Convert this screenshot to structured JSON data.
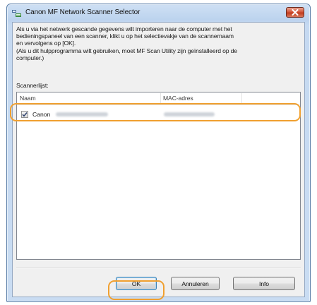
{
  "window": {
    "title": "Canon MF Network Scanner Selector",
    "close_icon": "close-x-icon",
    "app_icon": "scanner-selector-icon"
  },
  "description": {
    "lines": [
      "Als u via het netwerk gescande gegevens wilt importeren naar de computer met het",
      "bedieningspaneel van een scanner, klikt u op het selectievakje van de scannernaam",
      "en vervolgens op [OK].",
      "(Als u dit hulpprogramma wilt gebruiken, moet MF Scan Utility zijn geïnstalleerd op de",
      "computer.)"
    ]
  },
  "scanner_list": {
    "label": "Scannerlijst:",
    "columns": [
      "Naam",
      "MAC-adres"
    ],
    "rows": [
      {
        "checked": true,
        "name": "Canon",
        "name_detail": "[blurred]",
        "mac": "[blurred]"
      }
    ]
  },
  "buttons": {
    "ok": "OK",
    "cancel": "Annuleren",
    "info": "Info"
  },
  "colors": {
    "highlight": "#f0a030",
    "title_bar": "#bcd3ee",
    "close_button": "#c23d1f"
  }
}
